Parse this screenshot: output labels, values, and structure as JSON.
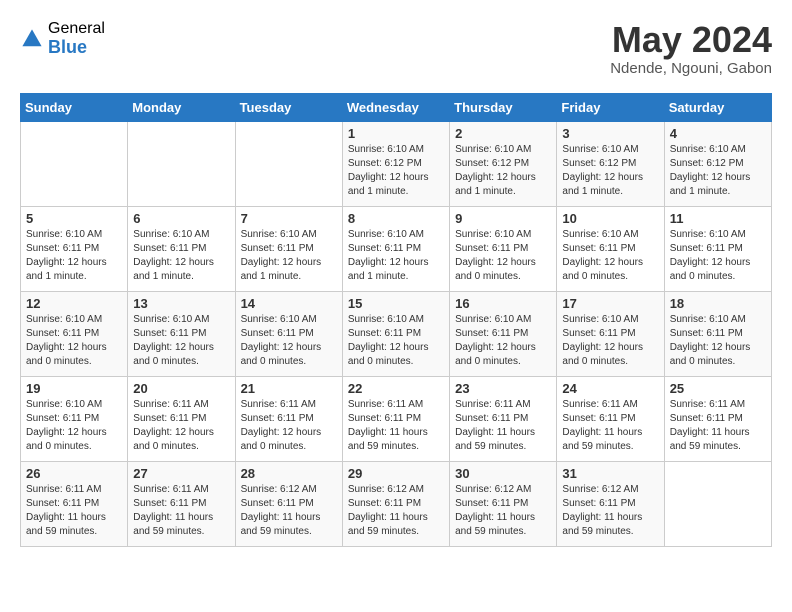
{
  "logo": {
    "general": "General",
    "blue": "Blue"
  },
  "header": {
    "month": "May 2024",
    "location": "Ndende, Ngouni, Gabon"
  },
  "weekdays": [
    "Sunday",
    "Monday",
    "Tuesday",
    "Wednesday",
    "Thursday",
    "Friday",
    "Saturday"
  ],
  "weeks": [
    [
      {
        "day": "",
        "sunrise": "",
        "sunset": "",
        "daylight": ""
      },
      {
        "day": "",
        "sunrise": "",
        "sunset": "",
        "daylight": ""
      },
      {
        "day": "",
        "sunrise": "",
        "sunset": "",
        "daylight": ""
      },
      {
        "day": "1",
        "sunrise": "Sunrise: 6:10 AM",
        "sunset": "Sunset: 6:12 PM",
        "daylight": "Daylight: 12 hours and 1 minute."
      },
      {
        "day": "2",
        "sunrise": "Sunrise: 6:10 AM",
        "sunset": "Sunset: 6:12 PM",
        "daylight": "Daylight: 12 hours and 1 minute."
      },
      {
        "day": "3",
        "sunrise": "Sunrise: 6:10 AM",
        "sunset": "Sunset: 6:12 PM",
        "daylight": "Daylight: 12 hours and 1 minute."
      },
      {
        "day": "4",
        "sunrise": "Sunrise: 6:10 AM",
        "sunset": "Sunset: 6:12 PM",
        "daylight": "Daylight: 12 hours and 1 minute."
      }
    ],
    [
      {
        "day": "5",
        "sunrise": "Sunrise: 6:10 AM",
        "sunset": "Sunset: 6:11 PM",
        "daylight": "Daylight: 12 hours and 1 minute."
      },
      {
        "day": "6",
        "sunrise": "Sunrise: 6:10 AM",
        "sunset": "Sunset: 6:11 PM",
        "daylight": "Daylight: 12 hours and 1 minute."
      },
      {
        "day": "7",
        "sunrise": "Sunrise: 6:10 AM",
        "sunset": "Sunset: 6:11 PM",
        "daylight": "Daylight: 12 hours and 1 minute."
      },
      {
        "day": "8",
        "sunrise": "Sunrise: 6:10 AM",
        "sunset": "Sunset: 6:11 PM",
        "daylight": "Daylight: 12 hours and 1 minute."
      },
      {
        "day": "9",
        "sunrise": "Sunrise: 6:10 AM",
        "sunset": "Sunset: 6:11 PM",
        "daylight": "Daylight: 12 hours and 0 minutes."
      },
      {
        "day": "10",
        "sunrise": "Sunrise: 6:10 AM",
        "sunset": "Sunset: 6:11 PM",
        "daylight": "Daylight: 12 hours and 0 minutes."
      },
      {
        "day": "11",
        "sunrise": "Sunrise: 6:10 AM",
        "sunset": "Sunset: 6:11 PM",
        "daylight": "Daylight: 12 hours and 0 minutes."
      }
    ],
    [
      {
        "day": "12",
        "sunrise": "Sunrise: 6:10 AM",
        "sunset": "Sunset: 6:11 PM",
        "daylight": "Daylight: 12 hours and 0 minutes."
      },
      {
        "day": "13",
        "sunrise": "Sunrise: 6:10 AM",
        "sunset": "Sunset: 6:11 PM",
        "daylight": "Daylight: 12 hours and 0 minutes."
      },
      {
        "day": "14",
        "sunrise": "Sunrise: 6:10 AM",
        "sunset": "Sunset: 6:11 PM",
        "daylight": "Daylight: 12 hours and 0 minutes."
      },
      {
        "day": "15",
        "sunrise": "Sunrise: 6:10 AM",
        "sunset": "Sunset: 6:11 PM",
        "daylight": "Daylight: 12 hours and 0 minutes."
      },
      {
        "day": "16",
        "sunrise": "Sunrise: 6:10 AM",
        "sunset": "Sunset: 6:11 PM",
        "daylight": "Daylight: 12 hours and 0 minutes."
      },
      {
        "day": "17",
        "sunrise": "Sunrise: 6:10 AM",
        "sunset": "Sunset: 6:11 PM",
        "daylight": "Daylight: 12 hours and 0 minutes."
      },
      {
        "day": "18",
        "sunrise": "Sunrise: 6:10 AM",
        "sunset": "Sunset: 6:11 PM",
        "daylight": "Daylight: 12 hours and 0 minutes."
      }
    ],
    [
      {
        "day": "19",
        "sunrise": "Sunrise: 6:10 AM",
        "sunset": "Sunset: 6:11 PM",
        "daylight": "Daylight: 12 hours and 0 minutes."
      },
      {
        "day": "20",
        "sunrise": "Sunrise: 6:11 AM",
        "sunset": "Sunset: 6:11 PM",
        "daylight": "Daylight: 12 hours and 0 minutes."
      },
      {
        "day": "21",
        "sunrise": "Sunrise: 6:11 AM",
        "sunset": "Sunset: 6:11 PM",
        "daylight": "Daylight: 12 hours and 0 minutes."
      },
      {
        "day": "22",
        "sunrise": "Sunrise: 6:11 AM",
        "sunset": "Sunset: 6:11 PM",
        "daylight": "Daylight: 11 hours and 59 minutes."
      },
      {
        "day": "23",
        "sunrise": "Sunrise: 6:11 AM",
        "sunset": "Sunset: 6:11 PM",
        "daylight": "Daylight: 11 hours and 59 minutes."
      },
      {
        "day": "24",
        "sunrise": "Sunrise: 6:11 AM",
        "sunset": "Sunset: 6:11 PM",
        "daylight": "Daylight: 11 hours and 59 minutes."
      },
      {
        "day": "25",
        "sunrise": "Sunrise: 6:11 AM",
        "sunset": "Sunset: 6:11 PM",
        "daylight": "Daylight: 11 hours and 59 minutes."
      }
    ],
    [
      {
        "day": "26",
        "sunrise": "Sunrise: 6:11 AM",
        "sunset": "Sunset: 6:11 PM",
        "daylight": "Daylight: 11 hours and 59 minutes."
      },
      {
        "day": "27",
        "sunrise": "Sunrise: 6:11 AM",
        "sunset": "Sunset: 6:11 PM",
        "daylight": "Daylight: 11 hours and 59 minutes."
      },
      {
        "day": "28",
        "sunrise": "Sunrise: 6:12 AM",
        "sunset": "Sunset: 6:11 PM",
        "daylight": "Daylight: 11 hours and 59 minutes."
      },
      {
        "day": "29",
        "sunrise": "Sunrise: 6:12 AM",
        "sunset": "Sunset: 6:11 PM",
        "daylight": "Daylight: 11 hours and 59 minutes."
      },
      {
        "day": "30",
        "sunrise": "Sunrise: 6:12 AM",
        "sunset": "Sunset: 6:11 PM",
        "daylight": "Daylight: 11 hours and 59 minutes."
      },
      {
        "day": "31",
        "sunrise": "Sunrise: 6:12 AM",
        "sunset": "Sunset: 6:11 PM",
        "daylight": "Daylight: 11 hours and 59 minutes."
      },
      {
        "day": "",
        "sunrise": "",
        "sunset": "",
        "daylight": ""
      }
    ]
  ]
}
